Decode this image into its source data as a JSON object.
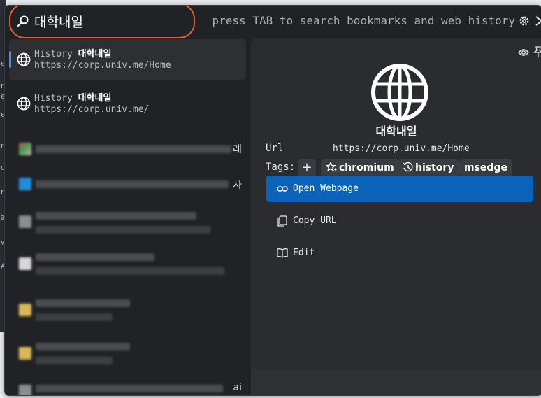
{
  "search": {
    "value": "대학내일",
    "hint": "press TAB to search bookmarks and web history"
  },
  "results": [
    {
      "source": "History",
      "name": "대학내일",
      "url": "https://corp.univ.me/Home",
      "selected": true
    },
    {
      "source": "History",
      "name": "대학내일",
      "url": "https://corp.univ.me/",
      "selected": false
    }
  ],
  "blurred_tails": [
    "레",
    "사",
    "ai"
  ],
  "details": {
    "title": "대학내일",
    "url_label": "Url",
    "url_value": "https://corp.univ.me/Home",
    "tags_label": "Tags:",
    "tags": [
      "chromium",
      "history",
      "msedge"
    ],
    "actions": {
      "open": "Open Webpage",
      "copy": "Copy URL",
      "edit": "Edit"
    }
  },
  "background_letters": [
    "e",
    "r",
    "e",
    "e",
    "r",
    "c",
    "r",
    "a",
    "v",
    "A"
  ],
  "colors": {
    "accent": "#0a63b8",
    "highlight_ring": "#e0623f",
    "selection_bar": "#4b8ee6"
  }
}
